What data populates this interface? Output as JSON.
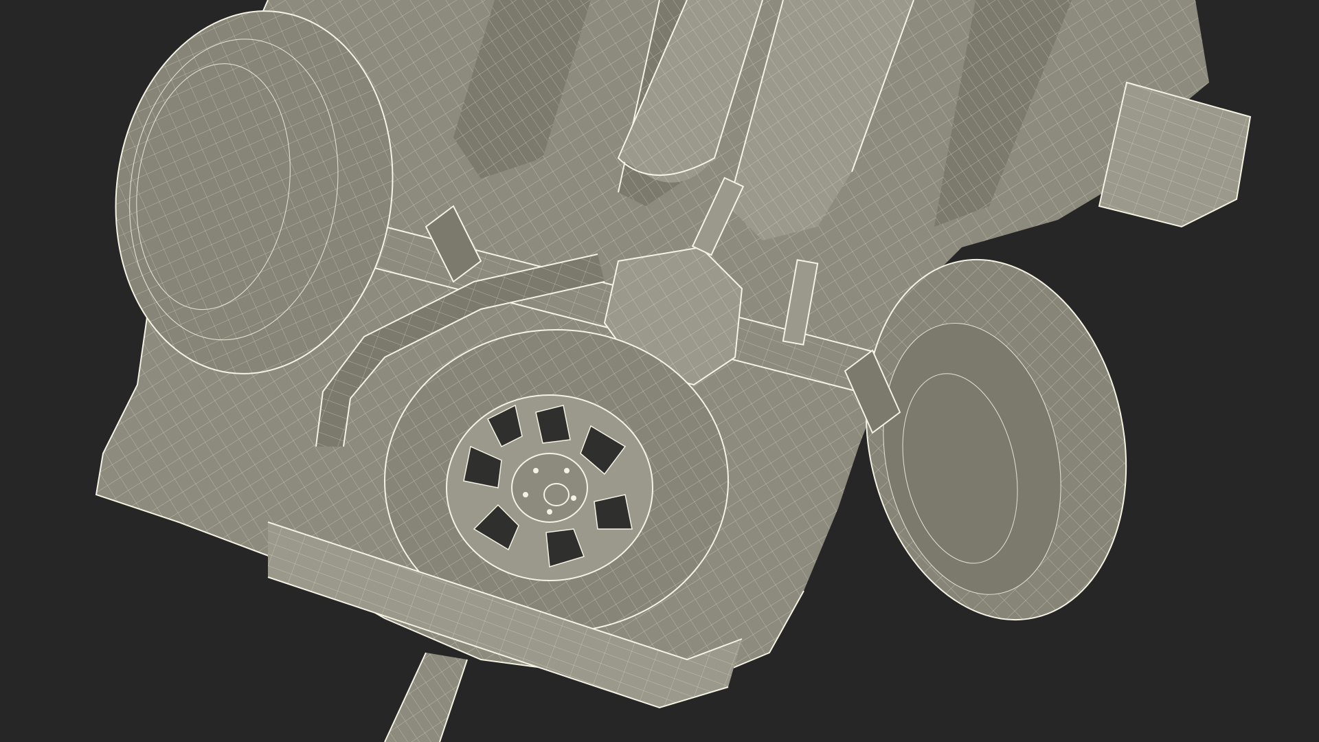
{
  "scene": {
    "subject": "",
    "colors": {
      "background": "#262626",
      "mesh_fill": "#8c8b7d",
      "wire": "#efefdc"
    }
  }
}
